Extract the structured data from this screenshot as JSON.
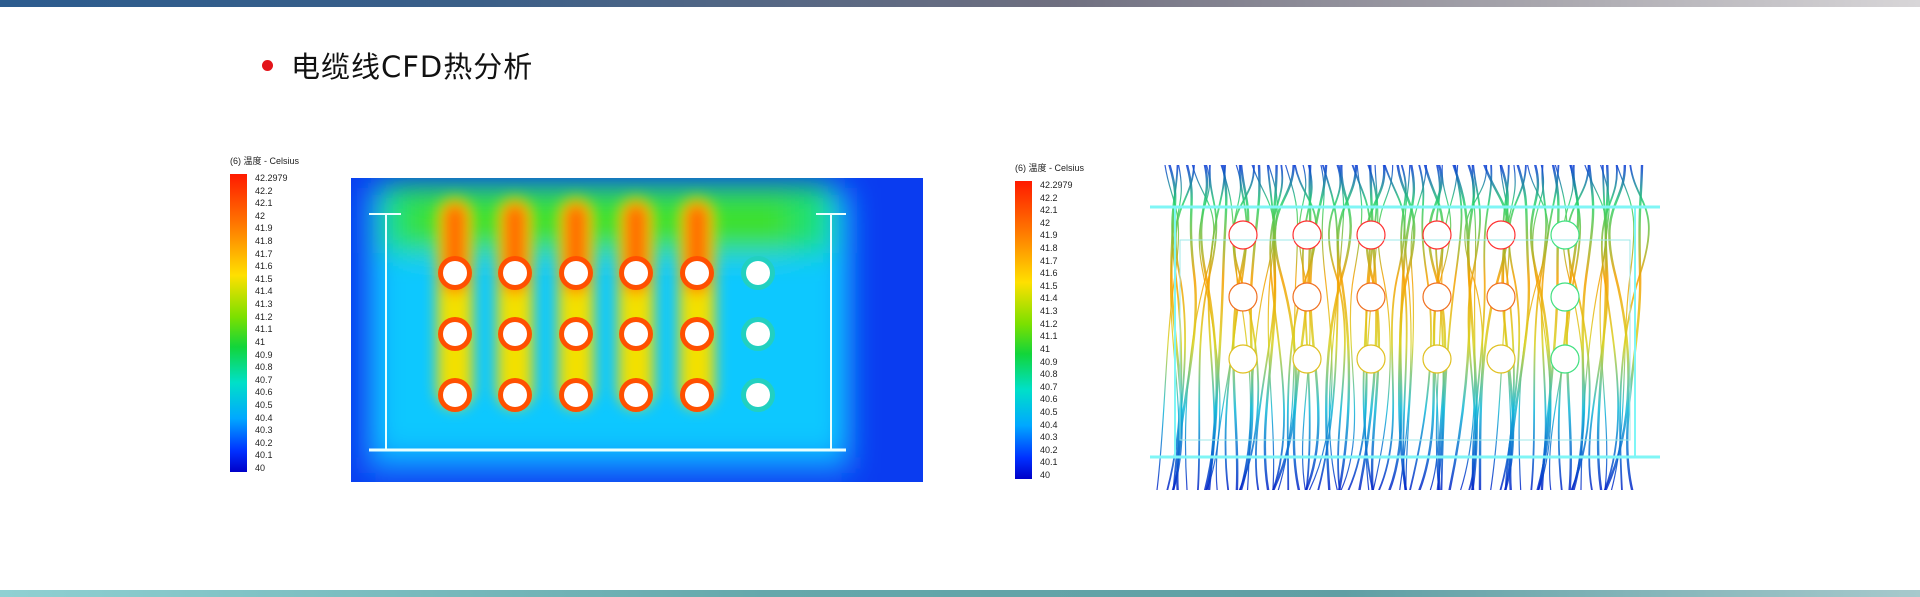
{
  "title": "电缆线CFD热分析",
  "legend_left": {
    "title": "(6) 温度 - Celsius",
    "ticks": [
      "42.2979",
      "42.2",
      "42.1",
      "42",
      "41.9",
      "41.8",
      "41.7",
      "41.6",
      "41.5",
      "41.4",
      "41.3",
      "41.2",
      "41.1",
      "41",
      "40.9",
      "40.8",
      "40.7",
      "40.6",
      "40.5",
      "40.4",
      "40.3",
      "40.2",
      "40.1",
      "40"
    ]
  },
  "legend_right": {
    "title": "(6) 温度 - Celsius",
    "ticks": [
      "42.2979",
      "42.2",
      "42.1",
      "42",
      "41.9",
      "41.8",
      "41.7",
      "41.6",
      "41.5",
      "41.4",
      "41.3",
      "41.2",
      "41.1",
      "41",
      "40.9",
      "40.8",
      "40.7",
      "40.6",
      "40.5",
      "40.4",
      "40.3",
      "40.2",
      "40.1",
      "40"
    ]
  },
  "colors": {
    "bullet": "#e3141a",
    "hot": "#ff1a00",
    "cold": "#0000c8",
    "frame": "#7ff6f6"
  }
}
